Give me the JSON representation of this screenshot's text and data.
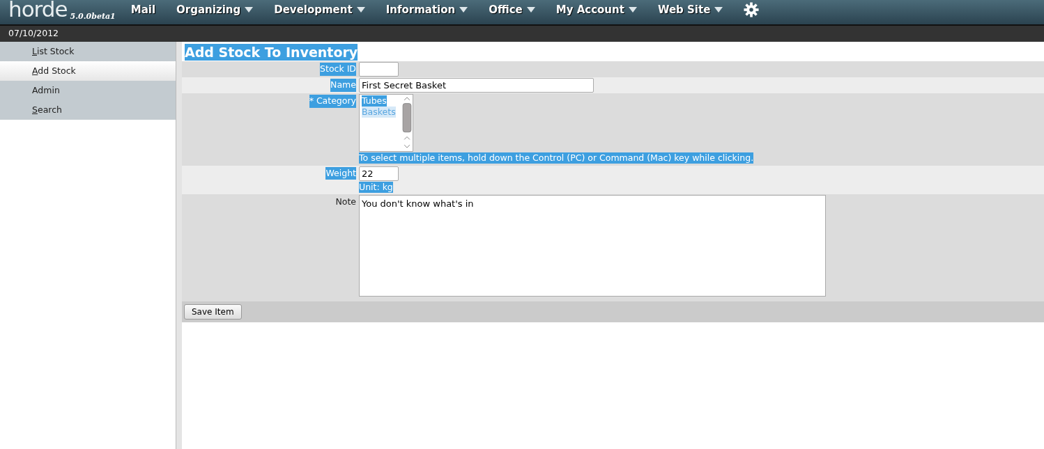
{
  "topbar": {
    "logo": "horde",
    "version": "5.0.0beta1",
    "menus": [
      {
        "label": "Mail",
        "dropdown": false
      },
      {
        "label": "Organizing",
        "dropdown": true
      },
      {
        "label": "Development",
        "dropdown": true
      },
      {
        "label": "Information",
        "dropdown": true
      },
      {
        "label": "Office",
        "dropdown": true
      },
      {
        "label": "My Account",
        "dropdown": true
      },
      {
        "label": "Web Site",
        "dropdown": true
      }
    ]
  },
  "date": "07/10/2012",
  "sidebar": {
    "items": [
      {
        "label": "List Stock",
        "selected": false,
        "shortcut_underlined": true
      },
      {
        "label": "Add Stock",
        "selected": true,
        "shortcut_underlined": true
      },
      {
        "label": "Admin",
        "selected": false,
        "shortcut_underlined": false
      },
      {
        "label": "Search",
        "selected": false,
        "shortcut_underlined": true
      }
    ]
  },
  "form": {
    "title": "Add Stock To Inventory",
    "title_highlighted": true,
    "fields": [
      {
        "kind": "short_text",
        "label": "Stock ID",
        "label_highlighted": true
      },
      {
        "kind": "long_text",
        "label": "Name",
        "label_highlighted": true,
        "value": "First Secret Basket"
      },
      {
        "kind": "listbox",
        "label": "* Category",
        "label_highlighted": true,
        "options": [
          {
            "label": "Tubes",
            "selected": true
          },
          {
            "label": "Baskets",
            "selected": false
          }
        ],
        "help": "To select multiple items, hold down the Control (PC) or Command (Mac) key while clicking.",
        "help_highlighted": true
      },
      {
        "kind": "short_text",
        "label": "Weight",
        "label_highlighted": true,
        "value": "22",
        "help": "Unit: kg",
        "help_highlighted": true
      },
      {
        "kind": "textarea",
        "label": "Note",
        "label_highlighted": false,
        "value": "You don't know what's in"
      }
    ],
    "submit": "Save Item"
  }
}
